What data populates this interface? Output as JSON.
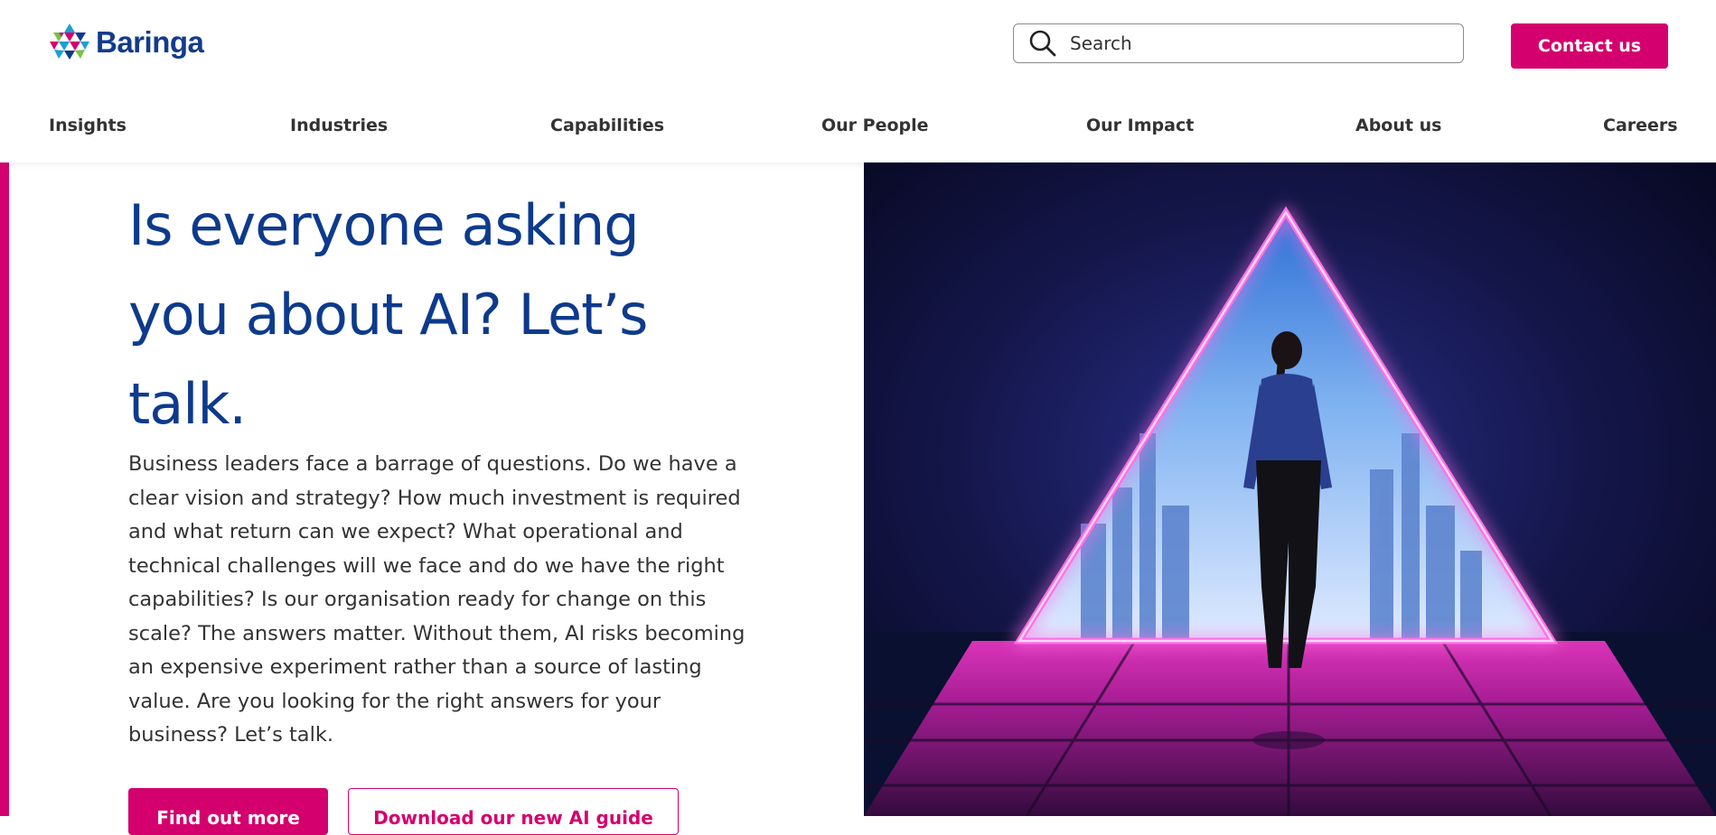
{
  "brand": {
    "name": "Baringa",
    "colors": {
      "primary_blue": "#0d3a8c",
      "accent_pink": "#d4006e",
      "text": "#333333"
    }
  },
  "header": {
    "search_placeholder": "Search",
    "contact_label": "Contact us"
  },
  "nav": {
    "items": [
      "Insights",
      "Industries",
      "Capabilities",
      "Our People",
      "Our Impact",
      "About us",
      "Careers"
    ]
  },
  "hero": {
    "title": "Is everyone asking you about AI? Let’s talk.",
    "body": "Business leaders face a barrage of questions. Do we have a clear vision and strategy? How much investment is required and what return can we expect? What operational and technical challenges will we face and do we have the right capabilities? Is our organisation ready for change on this scale? The answers matter. Without them, AI risks becoming an expensive experiment rather than a source of lasting value. Are you looking for the right answers for your business? Let’s talk.",
    "primary_cta": "Find out more",
    "secondary_cta": "Download our new AI guide"
  },
  "icons": [
    "baringa-logo-icon",
    "search-icon"
  ]
}
